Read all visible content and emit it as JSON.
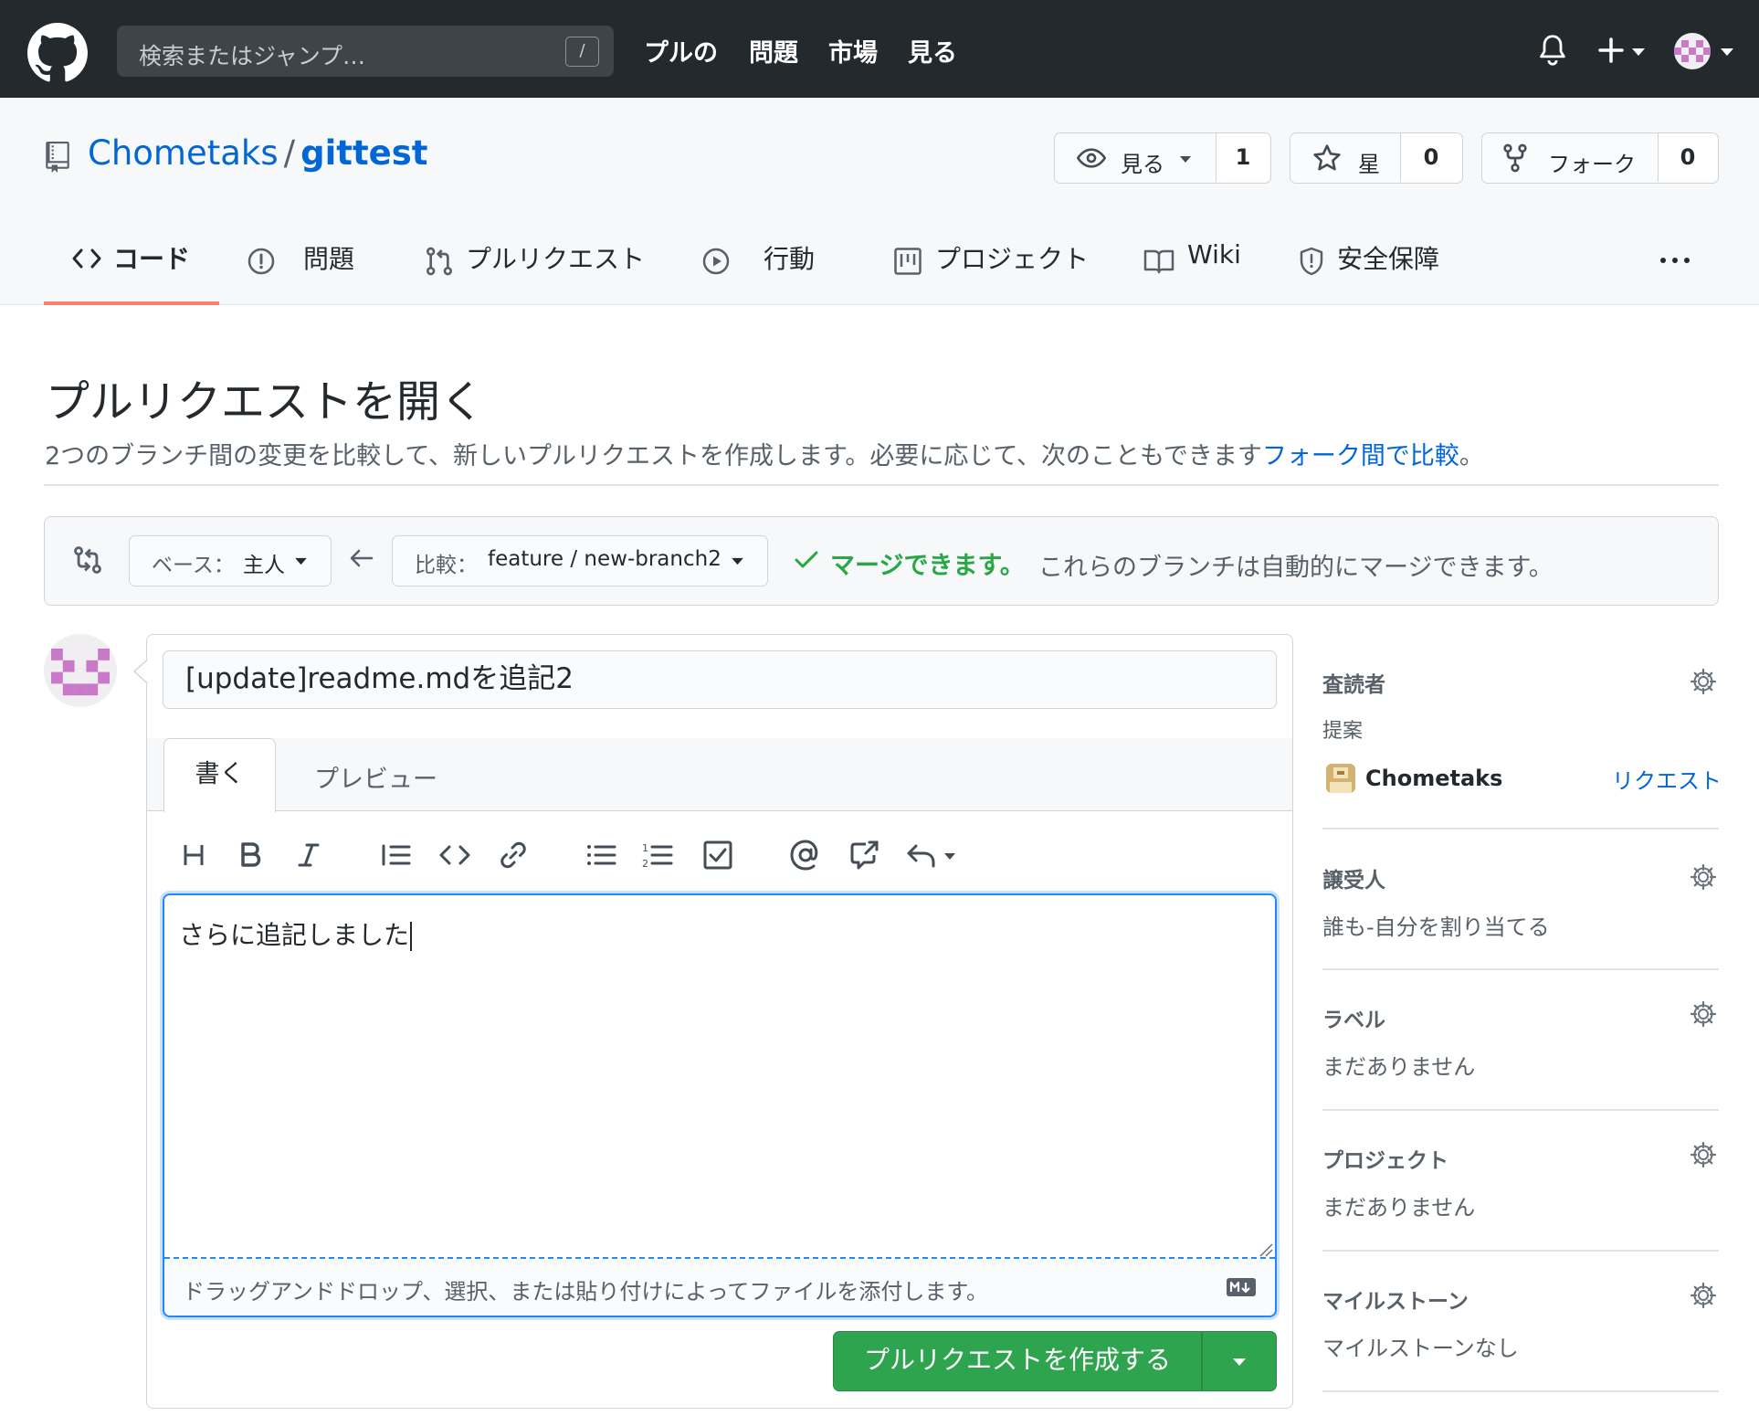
{
  "topbar": {
    "search_placeholder": "検索またはジャンプ…",
    "search_shortcut": "/",
    "nav": [
      "プルの",
      "問題",
      "市場",
      "見る"
    ]
  },
  "repo": {
    "owner": "Chometaks",
    "separator": "/",
    "name": "gittest",
    "watch": {
      "label": "見る",
      "count": "1"
    },
    "star": {
      "label": "星",
      "count": "0"
    },
    "fork": {
      "label": "フォーク",
      "count": "0"
    }
  },
  "tabs": {
    "code": "コード",
    "issues": "問題",
    "pulls": "プルリクエスト",
    "actions": "行動",
    "projects": "プロジェクト",
    "wiki": "Wiki",
    "security": "安全保障"
  },
  "page": {
    "title": "プルリクエストを開く",
    "description": "2つのブランチ間の変更を比較して、新しいプルリクエストを作成します。必要に応じて、次のこともできます",
    "description_link": "フォーク間で比較",
    "description_end": "。"
  },
  "compare": {
    "base_key": "ベース：",
    "base_value": "主人",
    "compare_key": "比較：",
    "compare_value": "feature / new-branch2",
    "merge_status": "マージできます。",
    "merge_message": "これらのブランチは自動的にマージできます。"
  },
  "form": {
    "title_value": "[update]readme.mdを追記2",
    "tab_write": "書く",
    "tab_preview": "プレビュー",
    "body_value": "さらに追記しました",
    "attach_hint": "ドラッグアンドドロップ、選択、または貼り付けによってファイルを添付します。",
    "submit_label": "プルリクエストを作成する"
  },
  "toolbar_icons": [
    "heading-icon",
    "bold-icon",
    "italic-icon",
    "quote-icon",
    "code-icon",
    "link-icon",
    "unordered-list-icon",
    "ordered-list-icon",
    "task-list-icon",
    "mention-icon",
    "cross-reference-icon",
    "reply-icon"
  ],
  "sidebar": {
    "reviewers": {
      "title": "査読者",
      "suggestion_label": "提案",
      "suggested_user": "Chometaks",
      "request_label": "リクエスト"
    },
    "assignees": {
      "title": "譲受人",
      "value": "誰も-自分を割り当てる"
    },
    "labels": {
      "title": "ラベル",
      "value": "まだありません"
    },
    "projects": {
      "title": "プロジェクト",
      "value": "まだありません"
    },
    "milestone": {
      "title": "マイルストーン",
      "value": "マイルストーンなし"
    }
  },
  "colors": {
    "header_bg": "#24292e",
    "link_blue": "#0366d6",
    "success_green": "#28a745",
    "button_green": "#2ea44f",
    "tab_underline": "#f9826c",
    "identicon": "#c879c8"
  }
}
